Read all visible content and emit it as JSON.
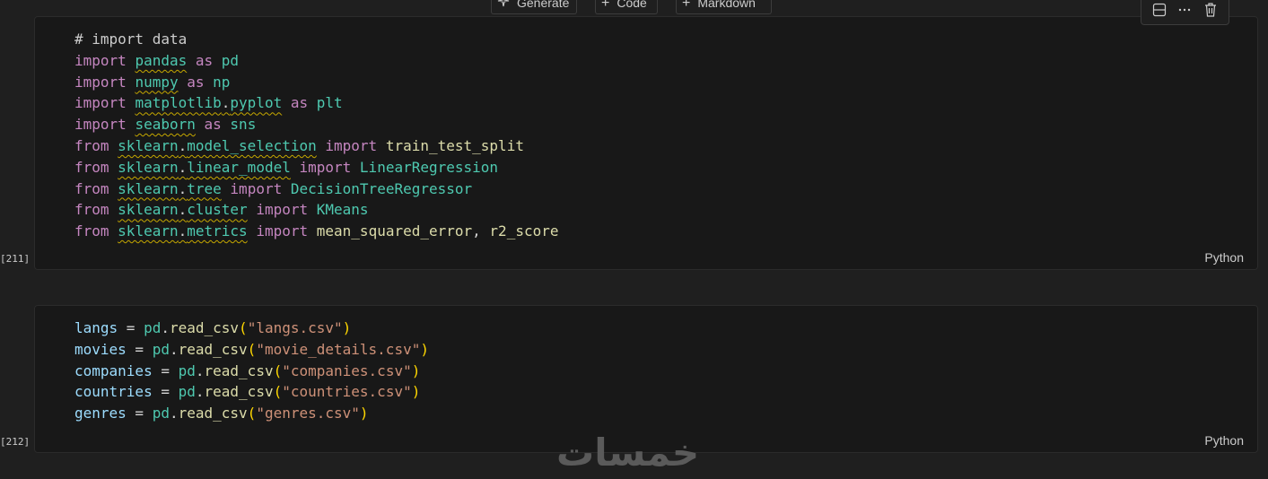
{
  "toolbar": {
    "generate_label": "Generate",
    "code_label": "Code",
    "markdown_label": "Markdown"
  },
  "cells": [
    {
      "execution_count": "[211]",
      "language": "Python",
      "lines": [
        [
          {
            "t": "# import data",
            "c": "cm"
          }
        ],
        [
          {
            "t": "import",
            "c": "kw"
          },
          {
            "t": " "
          },
          {
            "t": "pandas",
            "c": "mod sq"
          },
          {
            "t": " "
          },
          {
            "t": "as",
            "c": "kw"
          },
          {
            "t": " "
          },
          {
            "t": "pd",
            "c": "mod"
          }
        ],
        [
          {
            "t": "import",
            "c": "kw"
          },
          {
            "t": " "
          },
          {
            "t": "numpy",
            "c": "mod sq"
          },
          {
            "t": " "
          },
          {
            "t": "as",
            "c": "kw"
          },
          {
            "t": " "
          },
          {
            "t": "np",
            "c": "mod"
          }
        ],
        [
          {
            "t": "import",
            "c": "kw"
          },
          {
            "t": " "
          },
          {
            "t": "matplotlib",
            "c": "mod sq"
          },
          {
            "t": ".",
            "c": "sq"
          },
          {
            "t": "pyplot",
            "c": "mod sq"
          },
          {
            "t": " "
          },
          {
            "t": "as",
            "c": "kw"
          },
          {
            "t": " "
          },
          {
            "t": "plt",
            "c": "mod"
          }
        ],
        [
          {
            "t": "import",
            "c": "kw"
          },
          {
            "t": " "
          },
          {
            "t": "seaborn",
            "c": "mod sq"
          },
          {
            "t": " "
          },
          {
            "t": "as",
            "c": "kw"
          },
          {
            "t": " "
          },
          {
            "t": "sns",
            "c": "mod"
          }
        ],
        [
          {
            "t": "from",
            "c": "kw"
          },
          {
            "t": " "
          },
          {
            "t": "sklearn",
            "c": "mod sq"
          },
          {
            "t": ".",
            "c": "sq"
          },
          {
            "t": "model_selection",
            "c": "mod sq"
          },
          {
            "t": " "
          },
          {
            "t": "import",
            "c": "kw"
          },
          {
            "t": " "
          },
          {
            "t": "train_test_split",
            "c": "fn"
          }
        ],
        [
          {
            "t": "from",
            "c": "kw"
          },
          {
            "t": " "
          },
          {
            "t": "sklearn",
            "c": "mod sq"
          },
          {
            "t": ".",
            "c": "sq"
          },
          {
            "t": "linear_model",
            "c": "mod sq"
          },
          {
            "t": " "
          },
          {
            "t": "import",
            "c": "kw"
          },
          {
            "t": " "
          },
          {
            "t": "LinearRegression",
            "c": "mod"
          }
        ],
        [
          {
            "t": "from",
            "c": "kw"
          },
          {
            "t": " "
          },
          {
            "t": "sklearn",
            "c": "mod sq"
          },
          {
            "t": ".",
            "c": "sq"
          },
          {
            "t": "tree",
            "c": "mod sq"
          },
          {
            "t": " "
          },
          {
            "t": "import",
            "c": "kw"
          },
          {
            "t": " "
          },
          {
            "t": "DecisionTreeRegressor",
            "c": "mod"
          }
        ],
        [
          {
            "t": "from",
            "c": "kw"
          },
          {
            "t": " "
          },
          {
            "t": "sklearn",
            "c": "mod sq"
          },
          {
            "t": ".",
            "c": "sq"
          },
          {
            "t": "cluster",
            "c": "mod sq"
          },
          {
            "t": " "
          },
          {
            "t": "import",
            "c": "kw"
          },
          {
            "t": " "
          },
          {
            "t": "KMeans",
            "c": "mod"
          }
        ],
        [
          {
            "t": "from",
            "c": "kw"
          },
          {
            "t": " "
          },
          {
            "t": "sklearn",
            "c": "mod sq"
          },
          {
            "t": ".",
            "c": "sq"
          },
          {
            "t": "metrics",
            "c": "mod sq"
          },
          {
            "t": " "
          },
          {
            "t": "import",
            "c": "kw"
          },
          {
            "t": " "
          },
          {
            "t": "mean_squared_error",
            "c": "fn"
          },
          {
            "t": ", "
          },
          {
            "t": "r2_score",
            "c": "fn"
          }
        ]
      ]
    },
    {
      "execution_count": "[212]",
      "language": "Python",
      "lines": [
        [
          {
            "t": "langs",
            "c": "var"
          },
          {
            "t": " = "
          },
          {
            "t": "pd",
            "c": "mod"
          },
          {
            "t": "."
          },
          {
            "t": "read_csv",
            "c": "fn"
          },
          {
            "t": "(",
            "c": "br"
          },
          {
            "t": "\"langs.csv\"",
            "c": "str"
          },
          {
            "t": ")",
            "c": "br"
          }
        ],
        [
          {
            "t": "movies",
            "c": "var"
          },
          {
            "t": " = "
          },
          {
            "t": "pd",
            "c": "mod"
          },
          {
            "t": "."
          },
          {
            "t": "read_csv",
            "c": "fn"
          },
          {
            "t": "(",
            "c": "br"
          },
          {
            "t": "\"movie_details.csv\"",
            "c": "str"
          },
          {
            "t": ")",
            "c": "br"
          }
        ],
        [
          {
            "t": "companies",
            "c": "var"
          },
          {
            "t": " = "
          },
          {
            "t": "pd",
            "c": "mod"
          },
          {
            "t": "."
          },
          {
            "t": "read_csv",
            "c": "fn"
          },
          {
            "t": "(",
            "c": "br"
          },
          {
            "t": "\"companies.csv\"",
            "c": "str"
          },
          {
            "t": ")",
            "c": "br"
          }
        ],
        [
          {
            "t": "countries",
            "c": "var"
          },
          {
            "t": " = "
          },
          {
            "t": "pd",
            "c": "mod"
          },
          {
            "t": "."
          },
          {
            "t": "read_csv",
            "c": "fn"
          },
          {
            "t": "(",
            "c": "br"
          },
          {
            "t": "\"countries.csv\"",
            "c": "str"
          },
          {
            "t": ")",
            "c": "br"
          }
        ],
        [
          {
            "t": "genres",
            "c": "var"
          },
          {
            "t": " = "
          },
          {
            "t": "pd",
            "c": "mod"
          },
          {
            "t": "."
          },
          {
            "t": "read_csv",
            "c": "fn"
          },
          {
            "t": "(",
            "c": "br"
          },
          {
            "t": "\"genres.csv\"",
            "c": "str"
          },
          {
            "t": ")",
            "c": "br"
          }
        ]
      ]
    }
  ],
  "watermark": "خمسات",
  "colors": {
    "keyword": "#c586c0",
    "module": "#4ec9b0",
    "function": "#dcdcaa",
    "variable": "#9cdcfe",
    "string": "#ce9178",
    "bracket": "#ffd700",
    "squiggle": "#c6a800"
  }
}
